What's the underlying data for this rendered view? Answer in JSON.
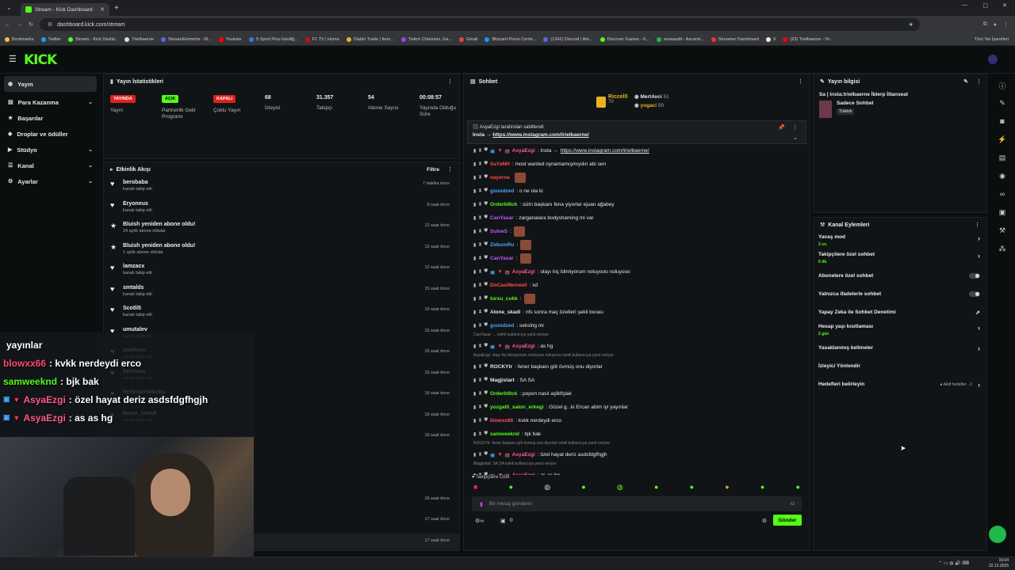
{
  "browser": {
    "tab_title": "Stream - Kick Dashboard",
    "url": "dashboard.kick.com/stream",
    "bookmarks": [
      "Bookmarks",
      "Twitter",
      "Stream - Kick Dashb..",
      "Trielbaerne",
      "StreamElements - M...",
      "Youtube",
      "S Sport Plus-İstediğ...",
      "F1 TV | Home",
      "Diablo Trade | Item...",
      "Twitch Channels, Ga...",
      "Gmail",
      "Blizzard Press Cente...",
      "(1342) Discord | Ark...",
      "Discover Games - K...",
      "wowaudit - Ascend...",
      "Streamer Dashboard",
      "X",
      "(23) Trielbaerne - Yo..."
    ],
    "all_bookmarks": "Tüm Yer İşaretleri"
  },
  "sidebar": {
    "items": [
      {
        "label": "Yayın",
        "active": true
      },
      {
        "label": "Para Kazanma",
        "chev": "⌄"
      },
      {
        "label": "Başarılar"
      },
      {
        "label": "Droplar ve ödüller"
      },
      {
        "label": "Stüdyo",
        "chev": "⌄"
      },
      {
        "label": "Kanal",
        "chev": "⌄"
      },
      {
        "label": "Ayarlar",
        "chev": "⌄"
      }
    ]
  },
  "stats": {
    "title": "Yayın İstatistikleri",
    "items": [
      {
        "badge": "YAYINDA",
        "badge_color": "#e0201c",
        "label": "Yayın"
      },
      {
        "badge": "AÇIK",
        "badge_color": "#53fc18",
        "label": "Partnerlik Gelir Programı"
      },
      {
        "badge": "KAPALI",
        "badge_color": "#e0201c",
        "label": "Çoklu Yayın"
      },
      {
        "value": "68",
        "label": "İzleyici"
      },
      {
        "value": "31.357",
        "label": "Takipçi"
      },
      {
        "value": "54",
        "label": "Abone Sayısı"
      },
      {
        "value": "00:08:57",
        "label": "Yayında Olduğu Süre"
      }
    ]
  },
  "activity": {
    "title": "Etkinlik Akışı",
    "filter": "Filtre",
    "events": [
      {
        "name": "berobaba",
        "sub": "kanalı takip etti",
        "time": "7 dakika önce",
        "icon": "♥"
      },
      {
        "name": "Eryoneus",
        "sub": "kanalı takip etti",
        "time": "8 saat önce",
        "icon": "♥"
      },
      {
        "name": "Bluish yeniden abone oldu!",
        "sub": "24 aylık abone oldular",
        "time": "12 saat önce",
        "icon": "★"
      },
      {
        "name": "Bluish yeniden abone oldu!",
        "sub": "1 aylık abone oldular",
        "time": "12 saat önce",
        "icon": "★"
      },
      {
        "name": "lamzacx",
        "sub": "kanalı takip etti",
        "time": "12 saat önce",
        "icon": "♥"
      },
      {
        "name": "smtalds",
        "sub": "kanalı takip etti",
        "time": "15 saat önce",
        "icon": "♥"
      },
      {
        "name": "Scotli5",
        "sub": "kanalı takip etti",
        "time": "15 saat önce",
        "icon": "♥"
      },
      {
        "name": "umutalev",
        "sub": "kanalı takip etti",
        "time": "15 saat önce",
        "icon": "♥"
      },
      {
        "name": "starksen",
        "sub": "kanalı takip etti",
        "time": "15 saat önce",
        "icon": "♥"
      },
      {
        "name": "kennssa",
        "sub": "kanalı takip etti",
        "time": "15 saat önce",
        "icon": "♥"
      },
      {
        "name": "herkesemokoko",
        "sub": "kanalı takip etti",
        "time": "16 saat önce",
        "icon": "♥"
      },
      {
        "name": "brave_enes6",
        "sub": "kanalı takip etti",
        "time": "16 saat önce",
        "icon": "♥"
      },
      {
        "name": "",
        "sub": "",
        "time": "16 saat önce",
        "icon": ""
      },
      {
        "name": "",
        "sub": "",
        "time": "",
        "icon": ""
      },
      {
        "name": "",
        "sub": "",
        "time": "",
        "icon": ""
      },
      {
        "name": "",
        "sub": "",
        "time": "16 saat önce",
        "icon": ""
      },
      {
        "name": "",
        "sub": "",
        "time": "17 saat önce",
        "icon": ""
      },
      {
        "name": "",
        "sub": "",
        "time": "17 saat önce",
        "icon": ""
      },
      {
        "name": "",
        "sub": "",
        "time": "17 saat önce",
        "icon": ""
      }
    ]
  },
  "overlay_chat": [
    {
      "user": "",
      "msg": "yayınlar",
      "color": "#ffffff"
    },
    {
      "user": "blowxx66",
      "msg": ": kvkk nerdeydi erco",
      "color": "#ff4a6a"
    },
    {
      "user": "samweeknd",
      "msg": ": bjk bak",
      "color": "#53fc18"
    },
    {
      "user": "AsyaEzgi",
      "msg": ": özel hayat deriz asdsfdgfhgjh",
      "color": "#ff5a8a"
    },
    {
      "user": "AsyaEzgi",
      "msg": ": as as hg",
      "color": "#ff5a8a"
    }
  ],
  "chat": {
    "title": "Sohbet",
    "top": [
      {
        "name": "Riccel0",
        "count": "70"
      },
      {
        "name": "MertAvci",
        "count": "51"
      },
      {
        "name": "yogaci",
        "count": "50"
      }
    ],
    "pinned_by": "AsyaEzgi tarafından sabitlendi",
    "pinned_msg": "Insta →",
    "pinned_link": "https://www.instagram.com/trielbaerne/",
    "messages": [
      {
        "user": "AsyaEzgi",
        "color": "#ff5a8a",
        "msg": ": Insta →",
        "link": "https://www.instagram.com/trielbaerne/"
      },
      {
        "user": "SaYaNH",
        "color": "#ff4a4a",
        "msg": ": most wanted oynamamışmıydın abi sen"
      },
      {
        "user": "nayerne",
        "color": "#ff4a4a",
        "msg": "",
        "emote": true
      },
      {
        "user": "gsundzed",
        "color": "#4aa8ff",
        "msg": ": o ne ola ki"
      },
      {
        "user": "OrderbI0ck",
        "color": "#53fc18",
        "msg": ": sizin başkanı fena yiyorlar ejuan ağabey"
      },
      {
        "user": "CanYasar",
        "color": "#c05aff",
        "msg": ": zarganalara bodyshaming mi var"
      },
      {
        "user": "SuloeS",
        "color": "#c05aff",
        "msg": ":",
        "emote": true
      },
      {
        "user": "ZiduonRu",
        "color": "#4aa8ff",
        "msg": ":",
        "emote": true
      },
      {
        "user": "CanYasar",
        "color": "#c05aff",
        "msg": ":",
        "emote": true
      },
      {
        "user": "AsyaEzgi",
        "color": "#ff5a8a",
        "msg": ": olayı hiç bilmiyorum noluyooo noluyooo"
      },
      {
        "user": "DoCasiNevwell",
        "color": "#ff4a4a",
        "msg": ": xd"
      },
      {
        "user": "tursu_cukk",
        "color": "#53fc18",
        "msg": ":",
        "emote": true
      },
      {
        "user": "Alone_skadi",
        "color": "#e6e6e6",
        "msg": ": nfs sonra maç özetleri şekli burası"
      },
      {
        "user": "gsundzed",
        "color": "#4aa8ff",
        "msg": ": sekslng mi"
      },
      {
        "reply": "CanYasar: ... isimli kullanıcıya yanıt veriyor"
      },
      {
        "user": "AsyaEzgi",
        "color": "#ff5a8a",
        "msg": ": as hg"
      },
      {
        "reply": "AsyaEzgi: olayı hiç bilmiyorum noluyooo noluyooo isimli kullanıcıya yanıt veriyor"
      },
      {
        "user": "ROCKYtr",
        "color": "#e6e6e6",
        "msg": ": fener başkanı göt övmüş onu diyorlar"
      },
      {
        "user": "Magjistart",
        "color": "#e6e6e6",
        "msg": ": SA SA"
      },
      {
        "user": "OrderbI0ck",
        "color": "#53fc18",
        "msg": ": popon nasıl aşlklfşlak"
      },
      {
        "user": "yozgatli_salon_erkegi",
        "color": "#53fc18",
        "msg": ": Güzel g...ki Ercan abim iyi yayınlar"
      },
      {
        "user": "blowxx66",
        "color": "#ff4a6a",
        "msg": ": kvkk nerdeydi erco"
      },
      {
        "user": "samweeknd",
        "color": "#53fc18",
        "msg": ": bjk bak"
      },
      {
        "reply": "ROCKYtr: fener başkanı göt övmüş onu diyorlar isimli kullanıcıya yanıt veriyor"
      },
      {
        "user": "AsyaEzgi",
        "color": "#ff5a8a",
        "msg": ": özel hayat deriz asdsfdgfhgjh"
      },
      {
        "reply": "Magjistart: SA SA isimli kullanıcıya yanıt veriyor"
      },
      {
        "user": "AsyaEzgi",
        "color": "#ff5a8a",
        "msg": ": as as hg"
      }
    ],
    "followers_only": "Takipçilere Özel",
    "input_placeholder": "Bir mesaj gönderin",
    "send_label": "Gönder",
    "counter": "0"
  },
  "stream_info": {
    "title": "Yayın bilgisi",
    "stream_title": "Sa | insta:trielbaerne İblerp İttanseat",
    "category": "Sadece Sohbet",
    "tag": "Türkish"
  },
  "channel_actions": {
    "title": "Kanal Eylemleri",
    "items": [
      {
        "label": "Yavaş mod",
        "sub": "2 sn.",
        "kind": "arrow"
      },
      {
        "label": "Takipçilere özel sohbet",
        "sub": "6 dk.",
        "kind": "arrow"
      },
      {
        "label": "Abonelere özel sohbet",
        "sub": "",
        "kind": "toggle"
      },
      {
        "label": "Yalnızca ifadelerle sohbet",
        "sub": "",
        "kind": "toggle"
      },
      {
        "label": "Yapay Zeka ile Sohbet Denetimi",
        "sub": "",
        "kind": "ext"
      },
      {
        "label": "Hesap yaşı kısıtlaması",
        "sub": "2 gün",
        "kind": "arrow"
      },
      {
        "label": "Yasaklanmış kelimeler",
        "sub": "",
        "kind": "arrow"
      },
      {
        "label": "İzleyici Yönlendir",
        "sub": "",
        "kind": "none"
      },
      {
        "label": "Hedefleri belirleyin",
        "sub": "",
        "kind": "goal",
        "extra": "Aktif hedefler - 2"
      }
    ]
  },
  "taskbar": {
    "time": "16:04",
    "date": "22.12.2025"
  }
}
